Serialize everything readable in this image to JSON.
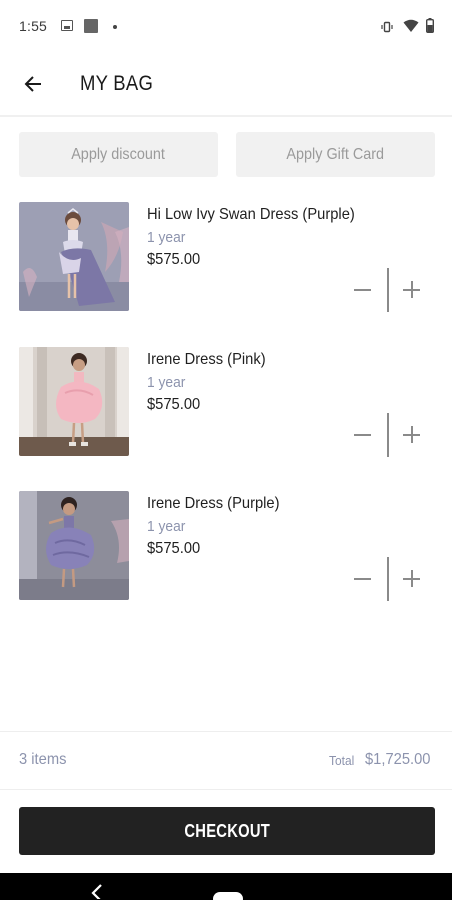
{
  "status_bar": {
    "time": "1:55"
  },
  "header": {
    "title": "MY BAG"
  },
  "actions": {
    "discount_label": "Apply discount",
    "gift_card_label": "Apply Gift Card"
  },
  "items": [
    {
      "name": "Hi Low Ivy Swan Dress (Purple)",
      "size": "1 year",
      "price": "$575.00"
    },
    {
      "name": "Irene Dress (Pink)",
      "size": "1 year",
      "price": "$575.00"
    },
    {
      "name": "Irene Dress (Purple)",
      "size": "1 year",
      "price": "$575.00"
    }
  ],
  "summary": {
    "items_count": "3 items",
    "total_label": "Total",
    "total_value": "$1,725.00"
  },
  "checkout": {
    "label": "CHECKOUT"
  },
  "colors": {
    "accent_dark": "#222222",
    "muted_text": "#8c93ad",
    "button_bg": "#f1f1f1"
  },
  "icons": {
    "back": "arrow-left-icon",
    "minus": "minus-icon",
    "plus": "plus-icon"
  }
}
